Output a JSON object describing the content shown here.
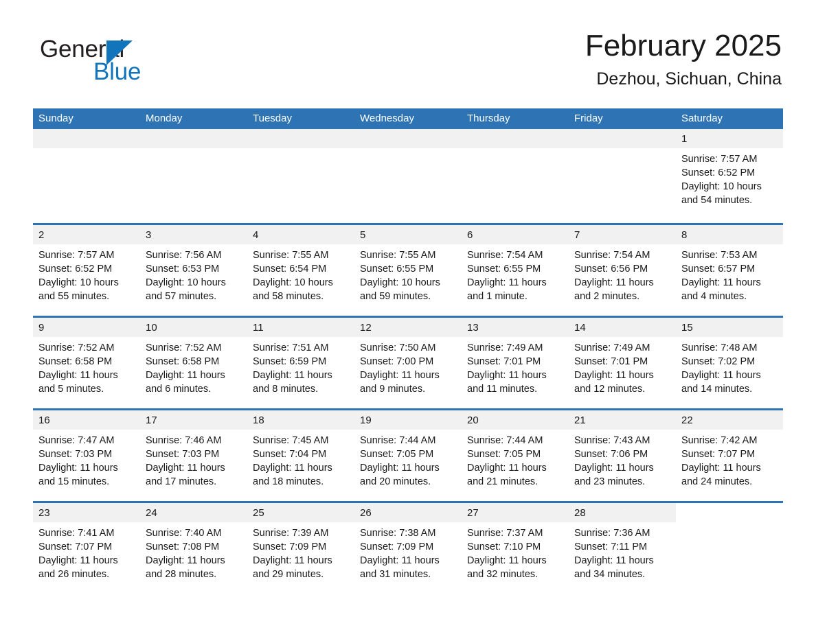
{
  "brand": {
    "name_part1": "General",
    "name_part2": "Blue",
    "flag_icon": "triangle-flag-icon",
    "colors": {
      "dark": "#231f20",
      "blue": "#1275bc"
    }
  },
  "header": {
    "month_title": "February 2025",
    "location": "Dezhou, Sichuan, China"
  },
  "calendar": {
    "header_bg": "#2e74b5",
    "daynum_bg": "#f1f1f1",
    "weekdays": [
      "Sunday",
      "Monday",
      "Tuesday",
      "Wednesday",
      "Thursday",
      "Friday",
      "Saturday"
    ],
    "weeks": [
      [
        {
          "day": "",
          "empty": true
        },
        {
          "day": "",
          "empty": true
        },
        {
          "day": "",
          "empty": true
        },
        {
          "day": "",
          "empty": true
        },
        {
          "day": "",
          "empty": true
        },
        {
          "day": "",
          "empty": true
        },
        {
          "day": "1",
          "sunrise": "Sunrise: 7:57 AM",
          "sunset": "Sunset: 6:52 PM",
          "daylight": "Daylight: 10 hours and 54 minutes."
        }
      ],
      [
        {
          "day": "2",
          "sunrise": "Sunrise: 7:57 AM",
          "sunset": "Sunset: 6:52 PM",
          "daylight": "Daylight: 10 hours and 55 minutes."
        },
        {
          "day": "3",
          "sunrise": "Sunrise: 7:56 AM",
          "sunset": "Sunset: 6:53 PM",
          "daylight": "Daylight: 10 hours and 57 minutes."
        },
        {
          "day": "4",
          "sunrise": "Sunrise: 7:55 AM",
          "sunset": "Sunset: 6:54 PM",
          "daylight": "Daylight: 10 hours and 58 minutes."
        },
        {
          "day": "5",
          "sunrise": "Sunrise: 7:55 AM",
          "sunset": "Sunset: 6:55 PM",
          "daylight": "Daylight: 10 hours and 59 minutes."
        },
        {
          "day": "6",
          "sunrise": "Sunrise: 7:54 AM",
          "sunset": "Sunset: 6:55 PM",
          "daylight": "Daylight: 11 hours and 1 minute."
        },
        {
          "day": "7",
          "sunrise": "Sunrise: 7:54 AM",
          "sunset": "Sunset: 6:56 PM",
          "daylight": "Daylight: 11 hours and 2 minutes."
        },
        {
          "day": "8",
          "sunrise": "Sunrise: 7:53 AM",
          "sunset": "Sunset: 6:57 PM",
          "daylight": "Daylight: 11 hours and 4 minutes."
        }
      ],
      [
        {
          "day": "9",
          "sunrise": "Sunrise: 7:52 AM",
          "sunset": "Sunset: 6:58 PM",
          "daylight": "Daylight: 11 hours and 5 minutes."
        },
        {
          "day": "10",
          "sunrise": "Sunrise: 7:52 AM",
          "sunset": "Sunset: 6:58 PM",
          "daylight": "Daylight: 11 hours and 6 minutes."
        },
        {
          "day": "11",
          "sunrise": "Sunrise: 7:51 AM",
          "sunset": "Sunset: 6:59 PM",
          "daylight": "Daylight: 11 hours and 8 minutes."
        },
        {
          "day": "12",
          "sunrise": "Sunrise: 7:50 AM",
          "sunset": "Sunset: 7:00 PM",
          "daylight": "Daylight: 11 hours and 9 minutes."
        },
        {
          "day": "13",
          "sunrise": "Sunrise: 7:49 AM",
          "sunset": "Sunset: 7:01 PM",
          "daylight": "Daylight: 11 hours and 11 minutes."
        },
        {
          "day": "14",
          "sunrise": "Sunrise: 7:49 AM",
          "sunset": "Sunset: 7:01 PM",
          "daylight": "Daylight: 11 hours and 12 minutes."
        },
        {
          "day": "15",
          "sunrise": "Sunrise: 7:48 AM",
          "sunset": "Sunset: 7:02 PM",
          "daylight": "Daylight: 11 hours and 14 minutes."
        }
      ],
      [
        {
          "day": "16",
          "sunrise": "Sunrise: 7:47 AM",
          "sunset": "Sunset: 7:03 PM",
          "daylight": "Daylight: 11 hours and 15 minutes."
        },
        {
          "day": "17",
          "sunrise": "Sunrise: 7:46 AM",
          "sunset": "Sunset: 7:03 PM",
          "daylight": "Daylight: 11 hours and 17 minutes."
        },
        {
          "day": "18",
          "sunrise": "Sunrise: 7:45 AM",
          "sunset": "Sunset: 7:04 PM",
          "daylight": "Daylight: 11 hours and 18 minutes."
        },
        {
          "day": "19",
          "sunrise": "Sunrise: 7:44 AM",
          "sunset": "Sunset: 7:05 PM",
          "daylight": "Daylight: 11 hours and 20 minutes."
        },
        {
          "day": "20",
          "sunrise": "Sunrise: 7:44 AM",
          "sunset": "Sunset: 7:05 PM",
          "daylight": "Daylight: 11 hours and 21 minutes."
        },
        {
          "day": "21",
          "sunrise": "Sunrise: 7:43 AM",
          "sunset": "Sunset: 7:06 PM",
          "daylight": "Daylight: 11 hours and 23 minutes."
        },
        {
          "day": "22",
          "sunrise": "Sunrise: 7:42 AM",
          "sunset": "Sunset: 7:07 PM",
          "daylight": "Daylight: 11 hours and 24 minutes."
        }
      ],
      [
        {
          "day": "23",
          "sunrise": "Sunrise: 7:41 AM",
          "sunset": "Sunset: 7:07 PM",
          "daylight": "Daylight: 11 hours and 26 minutes."
        },
        {
          "day": "24",
          "sunrise": "Sunrise: 7:40 AM",
          "sunset": "Sunset: 7:08 PM",
          "daylight": "Daylight: 11 hours and 28 minutes."
        },
        {
          "day": "25",
          "sunrise": "Sunrise: 7:39 AM",
          "sunset": "Sunset: 7:09 PM",
          "daylight": "Daylight: 11 hours and 29 minutes."
        },
        {
          "day": "26",
          "sunrise": "Sunrise: 7:38 AM",
          "sunset": "Sunset: 7:09 PM",
          "daylight": "Daylight: 11 hours and 31 minutes."
        },
        {
          "day": "27",
          "sunrise": "Sunrise: 7:37 AM",
          "sunset": "Sunset: 7:10 PM",
          "daylight": "Daylight: 11 hours and 32 minutes."
        },
        {
          "day": "28",
          "sunrise": "Sunrise: 7:36 AM",
          "sunset": "Sunset: 7:11 PM",
          "daylight": "Daylight: 11 hours and 34 minutes."
        },
        {
          "day": "",
          "empty_tail": true
        }
      ]
    ]
  }
}
